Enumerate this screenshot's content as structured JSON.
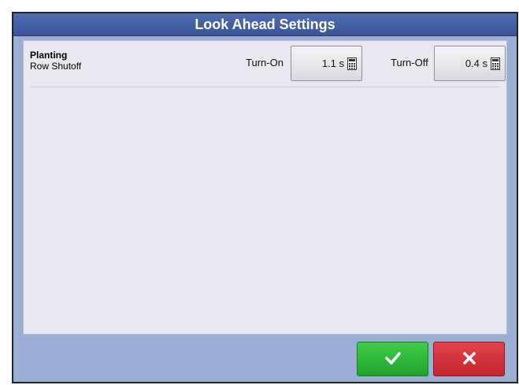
{
  "dialog": {
    "title": "Look Ahead Settings"
  },
  "row": {
    "title": "Planting",
    "subtitle": "Row Shutoff",
    "turn_on": {
      "label": "Turn-On",
      "value": "1.1 s"
    },
    "turn_off": {
      "label": "Turn-Off",
      "value": "0.4 s"
    }
  },
  "buttons": {
    "ok_icon": "check-icon",
    "cancel_icon": "close-icon",
    "ok_color": "#2bb537",
    "cancel_color": "#d1333b"
  }
}
